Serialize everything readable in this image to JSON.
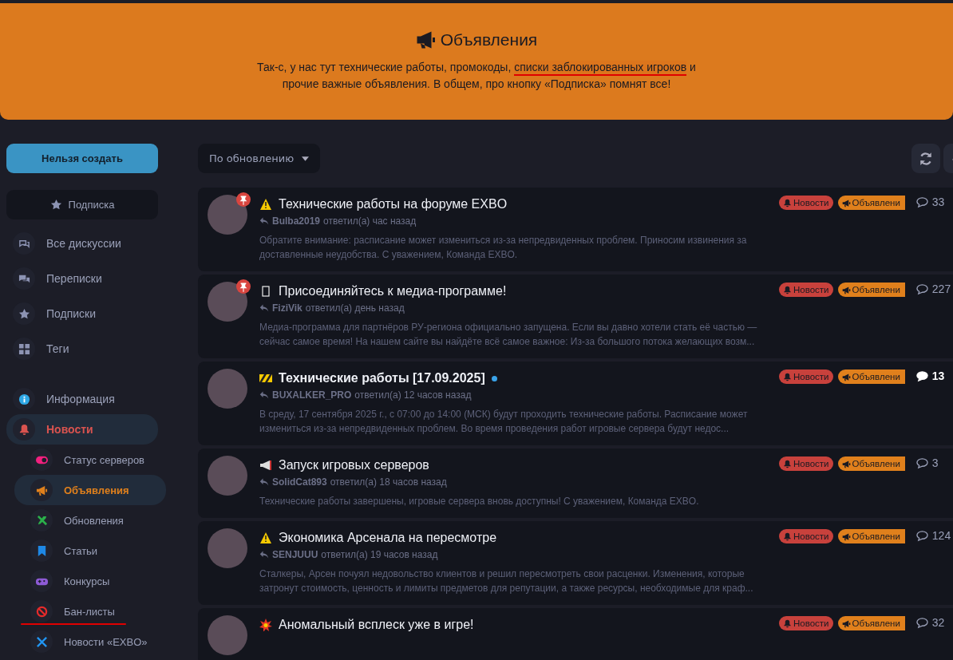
{
  "hero": {
    "title": "Объявления",
    "text": [
      {
        "t": "Так-с, у нас тут технические работы, промокоды, ",
        "underlined": false
      },
      {
        "t": "списки заблокированных игроков",
        "underlined": true
      },
      {
        "t": " и прочие важные объявления. В общем, про кнопку «Подписка» помнят все!",
        "underlined": false
      }
    ]
  },
  "sidebar": {
    "create_button": "Нельзя создать",
    "subscribe_button": "Подписка",
    "nav": [
      {
        "label": "Все дискуссии"
      },
      {
        "label": "Переписки"
      },
      {
        "label": "Подписки"
      },
      {
        "label": "Теги"
      }
    ],
    "tags": [
      {
        "label": "Информация",
        "selected": false,
        "underlined": false
      },
      {
        "label": "Новости",
        "selected": true,
        "underlined": false,
        "children": [
          {
            "label": "Статус серверов",
            "selected": false,
            "underlined": false
          },
          {
            "label": "Объявления",
            "selected": true,
            "underlined": false
          },
          {
            "label": "Обновления",
            "selected": false,
            "underlined": false
          },
          {
            "label": "Статьи",
            "selected": false,
            "underlined": false
          },
          {
            "label": "Конкурсы",
            "selected": false,
            "underlined": false
          },
          {
            "label": "Бан-листы",
            "selected": false,
            "underlined": true
          },
          {
            "label": "Новости «EXBO»",
            "selected": false,
            "underlined": false
          }
        ]
      }
    ]
  },
  "toolbar": {
    "sort": "По обновлению"
  },
  "posts": [
    {
      "title": "Технические работы на форуме EXBO",
      "kind": "warning",
      "pinned": true,
      "unread": false,
      "author": "Bulba2019",
      "action": "ответил(а) час назад",
      "excerpt": "Обратите внимание: расписание может измениться из-за непредвиденных проблем. Приносим извинения за доставленные неудобства. С уважением, Команда EXBO.",
      "tags": [
        {
          "label": "Новости",
          "color": "#c8413c"
        },
        {
          "label": "Объявлени",
          "color": "#e0801c"
        }
      ],
      "count": "33"
    },
    {
      "title": "Присоединяйтесь к медиа-программе!",
      "kind": "missing",
      "pinned": true,
      "unread": false,
      "author": "FiziVik",
      "action": "ответил(а) день назад",
      "excerpt": "Медиа-программа для партнёров РУ-региона официально запущена. Если вы давно хотели стать её частью — сейчас самое время! На нашем сайте вы найдёте всё самое важное: Из-за большого потока желающих возм...",
      "tags": [
        {
          "label": "Новости",
          "color": "#c8413c"
        },
        {
          "label": "Объявлени",
          "color": "#e0801c"
        }
      ],
      "count": "227"
    },
    {
      "title": "Технические работы [17.09.2025]",
      "kind": "barrier",
      "pinned": false,
      "unread": true,
      "author": "BUXALKER_PRO",
      "action": "ответил(а) 12 часов назад",
      "excerpt": "В среду, 17 сентября 2025 г., с 07:00 до 14:00 (МСК) будут проходить технические работы. Расписание может измениться из-за непредвиденных проблем. Во время проведения работ игровые сервера будут недос...",
      "tags": [
        {
          "label": "Новости",
          "color": "#c8413c"
        },
        {
          "label": "Объявлени",
          "color": "#e0801c"
        }
      ],
      "count": "13"
    },
    {
      "title": "Запуск игровых серверов",
      "kind": "megaphone",
      "pinned": false,
      "unread": false,
      "author": "SolidCat893",
      "action": "ответил(а) 18 часов назад",
      "excerpt": "Технические работы завершены, игровые сервера вновь доступны! С уважением, Команда EXBO.",
      "tags": [
        {
          "label": "Новости",
          "color": "#c8413c"
        },
        {
          "label": "Объявлени",
          "color": "#e0801c"
        }
      ],
      "count": "3"
    },
    {
      "title": "Экономика Арсенала на пересмотре",
      "kind": "warning",
      "pinned": false,
      "unread": false,
      "author": "SENJUUU",
      "action": "ответил(а) 19 часов назад",
      "excerpt": "Сталкеры, Арсен почуял недовольство клиентов и решил пересмотреть свои расценки. Изменения, которые затронут стоимость, ценность и лимиты предметов для репутации, а также ресурсы, необходимые для краф...",
      "tags": [
        {
          "label": "Новости",
          "color": "#c8413c"
        },
        {
          "label": "Объявлени",
          "color": "#e0801c"
        }
      ],
      "count": "124"
    },
    {
      "title": "Аномальный всплеск уже в игре!",
      "kind": "explosion",
      "pinned": false,
      "unread": false,
      "tags": [
        {
          "label": "Новости",
          "color": "#c8413c"
        },
        {
          "label": "Объявлени",
          "color": "#e0801c"
        }
      ],
      "count": "32"
    }
  ]
}
